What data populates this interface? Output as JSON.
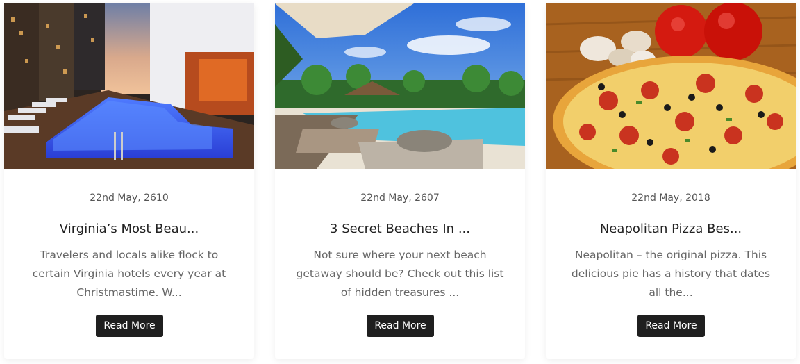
{
  "cards": [
    {
      "image": "hotel-rooftop-pool-at-dusk",
      "date": "22nd May, 2610",
      "title": "Virginia’s Most Beau...",
      "excerpt": "Travelers and locals alike flock to certain Virginia hotels every year at Christmastime. W...",
      "button": "Read More"
    },
    {
      "image": "tropical-resort-pool-with-palms",
      "date": "22nd May, 2607",
      "title": "3 Secret Beaches In ...",
      "excerpt": "Not sure where your next beach getaway should be? Check out this list of hidden treasures ...",
      "button": "Read More"
    },
    {
      "image": "pepperoni-pizza-with-tomatoes",
      "date": "22nd May, 2018",
      "title": "Neapolitan Pizza Bes...",
      "excerpt": "Neapolitan – the original pizza. This delicious pie has a history that dates all the...",
      "button": "Read More"
    }
  ]
}
